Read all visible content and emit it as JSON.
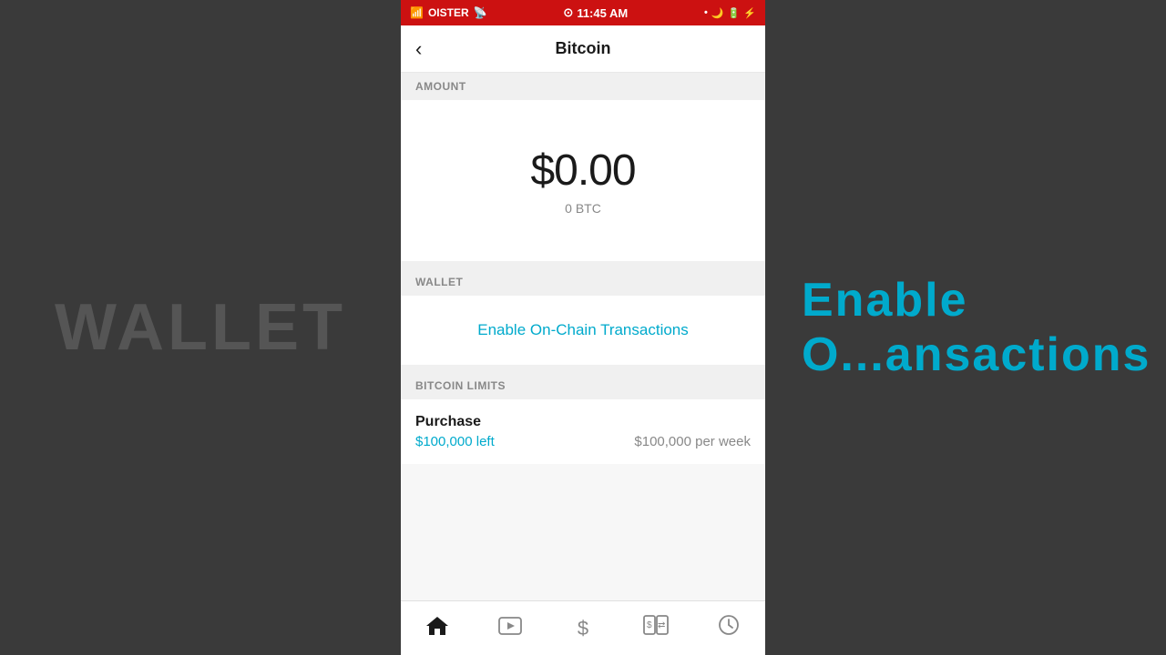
{
  "background": {
    "left_text": "WALLET",
    "right_text": "Enable O...ansactions"
  },
  "status_bar": {
    "carrier": "OISTER",
    "time": "11:45 AM",
    "color": "#cc1111"
  },
  "header": {
    "title": "Bitcoin",
    "back_label": "‹"
  },
  "sections": {
    "amount": {
      "label": "AMOUNT",
      "usd_value": "$0.00",
      "btc_value": "0 BTC"
    },
    "wallet": {
      "label": "WALLET",
      "enable_link": "Enable On-Chain Transactions"
    },
    "limits": {
      "label": "BITCOIN LIMITS",
      "purchase": {
        "title": "Purchase",
        "left_amount": "$100,000 left",
        "right_amount": "$100,000 per week"
      }
    }
  },
  "bottom_nav": {
    "items": [
      {
        "id": "home",
        "icon": "🏠",
        "active": true
      },
      {
        "id": "video",
        "icon": "▶",
        "active": false
      },
      {
        "id": "dollar",
        "icon": "$",
        "active": false
      },
      {
        "id": "transfer",
        "icon": "⇄",
        "active": false
      },
      {
        "id": "clock",
        "icon": "🕐",
        "active": false
      }
    ]
  }
}
